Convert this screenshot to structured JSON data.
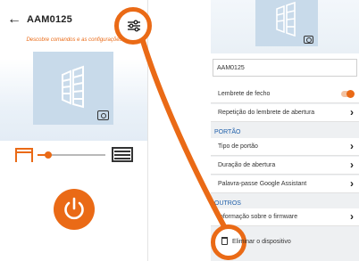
{
  "left_screen": {
    "back_icon": "arrow-left-icon",
    "title": "AAM0125",
    "hint": "Descobre comandos e as configurações",
    "settings_icon": "sliders-icon",
    "open_gate_icon": "gate-open-icon",
    "closed_gate_icon": "gate-closed-icon",
    "power_icon": "power-icon",
    "slider_position": 0.1
  },
  "right_screen": {
    "device_name_value": "AAM0125",
    "rows": [
      {
        "label": "Lembrete de fecho",
        "control": "toggle",
        "state": "on"
      },
      {
        "label": "Repetição do lembrete de abertura",
        "control": "chevron"
      }
    ],
    "section_portao": "PORTÃO",
    "portao_rows": [
      {
        "label": "Tipo de portão"
      },
      {
        "label": "Duração de abertura"
      },
      {
        "label": "Palavra-passe Google Assistant"
      }
    ],
    "section_outros": "OUTROS",
    "outros_rows": [
      {
        "label": "Informação sobre o firmware"
      }
    ],
    "delete_label": "Eliminar o dispositivo",
    "delete_icon": "trash-icon"
  },
  "colors": {
    "accent": "#ea6a16",
    "tile": "#c8daea",
    "section_text": "#1f5faa"
  }
}
